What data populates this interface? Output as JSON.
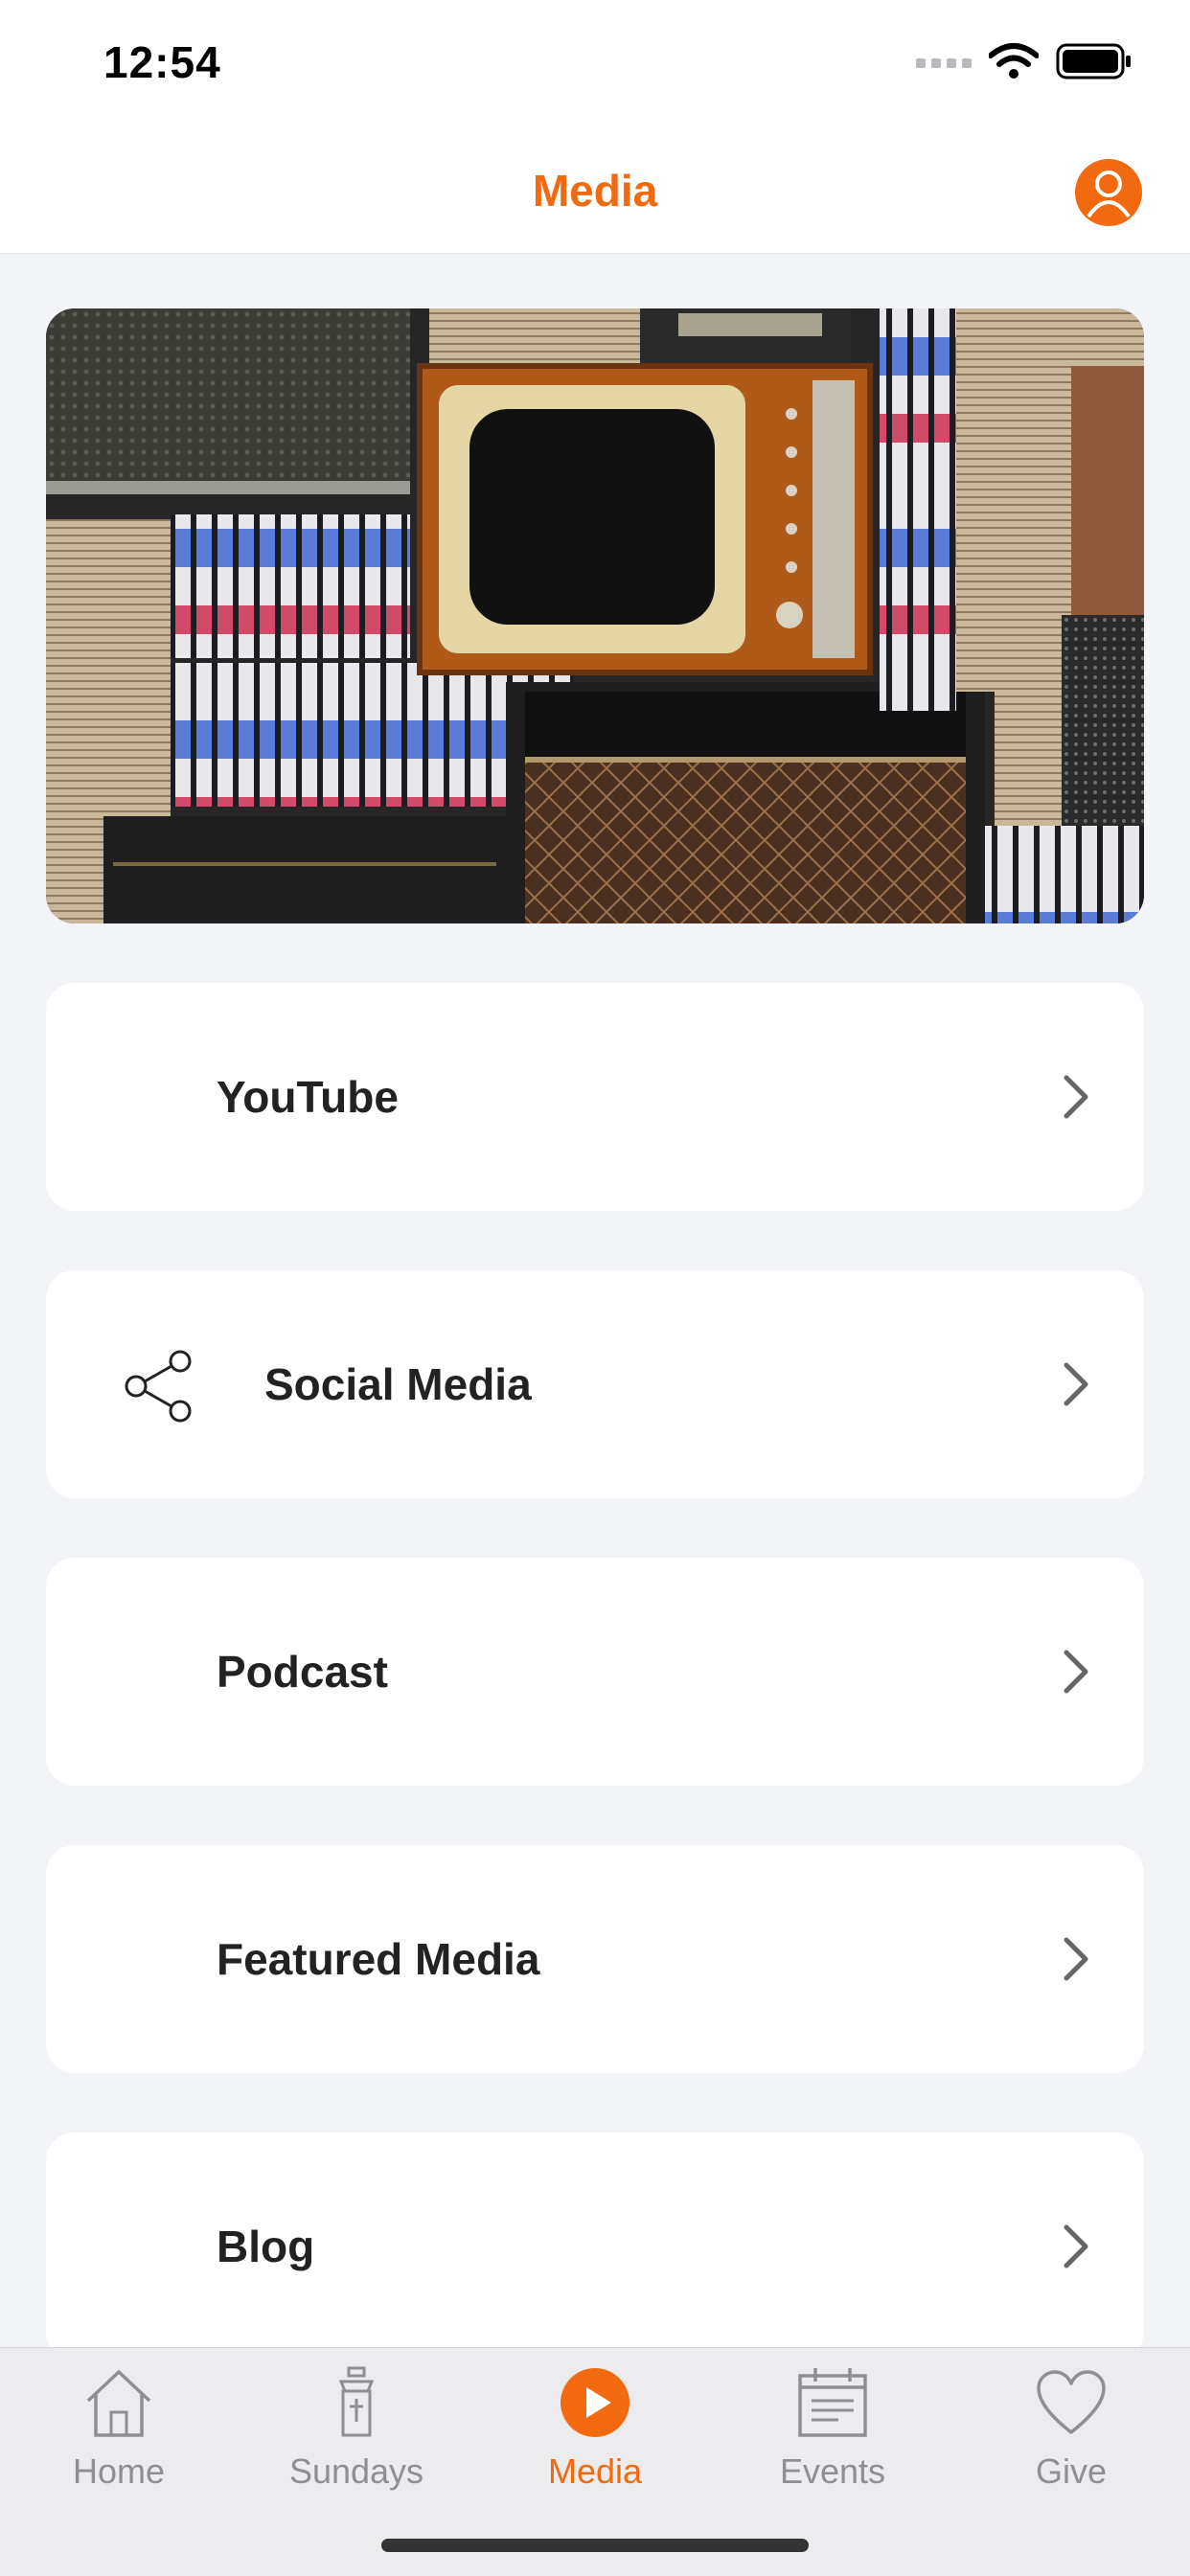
{
  "status_bar": {
    "time": "12:54"
  },
  "header": {
    "title": "Media",
    "profile_icon": "person-circle-icon"
  },
  "hero": {
    "image": "vintage-tv-vhs-records-photo"
  },
  "menu": [
    {
      "label": "YouTube",
      "icon": ""
    },
    {
      "label": "Social Media",
      "icon": "share-icon"
    },
    {
      "label": "Podcast",
      "icon": ""
    },
    {
      "label": "Featured Media",
      "icon": ""
    },
    {
      "label": "Blog",
      "icon": ""
    }
  ],
  "tabs": [
    {
      "label": "Home",
      "icon": "house-icon"
    },
    {
      "label": "Sundays",
      "icon": "church-icon"
    },
    {
      "label": "Media",
      "icon": "play-circle-icon",
      "active": true
    },
    {
      "label": "Events",
      "icon": "calendar-icon"
    },
    {
      "label": "Give",
      "icon": "heart-icon"
    }
  ],
  "colors": {
    "accent": "#f26a10",
    "background": "#f2f4f7",
    "tab_inactive": "#8e8e93"
  }
}
